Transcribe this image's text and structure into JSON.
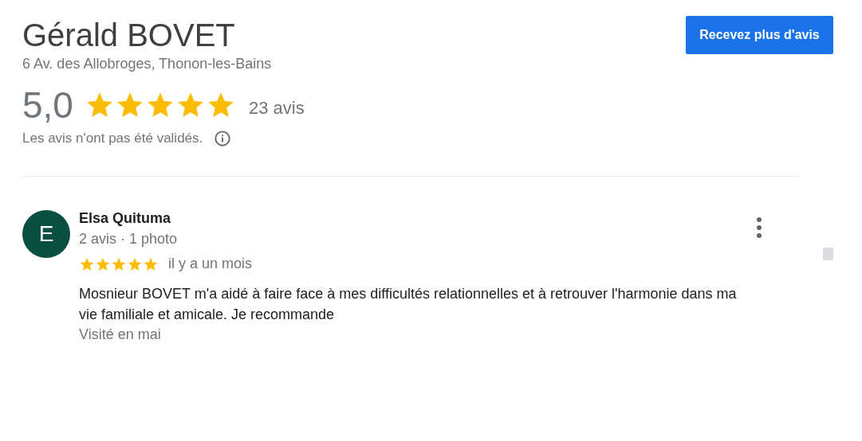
{
  "business": {
    "name": "Gérald BOVET",
    "address": "6 Av. des Allobroges, Thonon-les-Bains"
  },
  "get_reviews_button": "Recevez plus d'avis",
  "rating": {
    "score": "5,0",
    "stars": 5,
    "count": "23 avis",
    "notice": "Les avis n'ont pas été validés."
  },
  "reviews": [
    {
      "avatar_letter": "E",
      "author": "Elsa Quituma",
      "meta": "2 avis · 1 photo",
      "stars": 5,
      "date": "il y a un mois",
      "text": "Mosnieur BOVET m'a aidé à faire face à mes difficultés relationnelles et à retrouver l'harmonie dans ma vie familiale et amicale. Je recommande",
      "visit": "Visité en mai"
    }
  ]
}
